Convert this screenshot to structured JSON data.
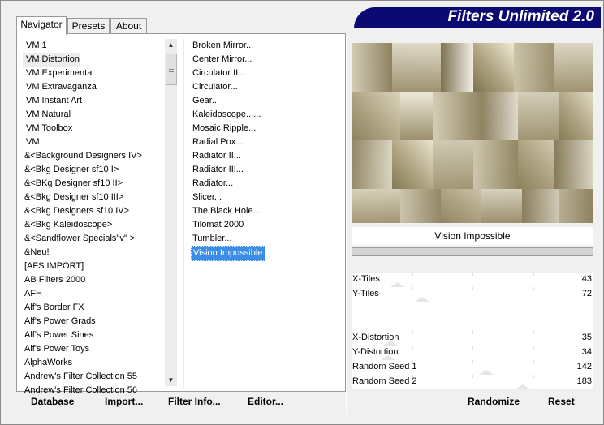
{
  "tabs": [
    {
      "label": "Navigator",
      "active": true
    },
    {
      "label": "Presets",
      "active": false
    },
    {
      "label": "About",
      "active": false
    }
  ],
  "banner_title": "Filters Unlimited 2.0",
  "categories": [
    "VM 1",
    "VM Distortion",
    "VM Experimental",
    "VM Extravaganza",
    "VM Instant Art",
    "VM Natural",
    "VM Toolbox",
    "VM",
    "&<Background Designers IV>",
    "&<Bkg Designer sf10 I>",
    "&<BKg Designer sf10 II>",
    "&<Bkg Designer sf10 III>",
    "&<Bkg Designers sf10 IV>",
    "&<Bkg Kaleidoscope>",
    "&<Sandflower Specials\"v\" >",
    "&Neu!",
    "[AFS IMPORT]",
    "AB Filters 2000",
    "AFH",
    "Alf's Border FX",
    "Alf's Power Grads",
    "Alf's Power Sines",
    "Alf's Power Toys",
    "AlphaWorks",
    "Andrew's Filter Collection 55",
    "Andrew's Filter Collection 56"
  ],
  "selected_category": "VM Distortion",
  "filters": [
    "Broken Mirror...",
    "Center Mirror...",
    "Circulator II...",
    "Circulator...",
    "Gear...",
    "Kaleidoscope......",
    "Mosaic Ripple...",
    "Radial Pox...",
    "Radiator II...",
    "Radiator III...",
    "Radiator...",
    "Slicer...",
    "The Black Hole...",
    "Tilomat 2000",
    "Tumbler...",
    "Vision Impossible"
  ],
  "selected_filter": "Vision Impossible",
  "bottom_buttons": {
    "database": "Database",
    "import": "Import...",
    "filter_info": "Filter Info...",
    "editor": "Editor...",
    "randomize": "Randomize",
    "reset": "Reset"
  },
  "preview_label": "Vision Impossible",
  "parameters": [
    {
      "label": "X-Tiles",
      "value": "43",
      "level": 0.17
    },
    {
      "label": "Y-Tiles",
      "value": "72",
      "level": 0.28
    },
    {
      "label": "X-Distortion",
      "value": "35",
      "level": 0.14
    },
    {
      "label": "Y-Distortion",
      "value": "34",
      "level": 0.13
    },
    {
      "label": "Random Seed 1",
      "value": "142",
      "level": 0.56
    },
    {
      "label": "Random Seed 2",
      "value": "183",
      "level": 0.72
    }
  ],
  "colors": {
    "banner_bg": "#0a0a72",
    "selection_bg": "#3a8ee8",
    "preview_base": "#9a8c66"
  }
}
